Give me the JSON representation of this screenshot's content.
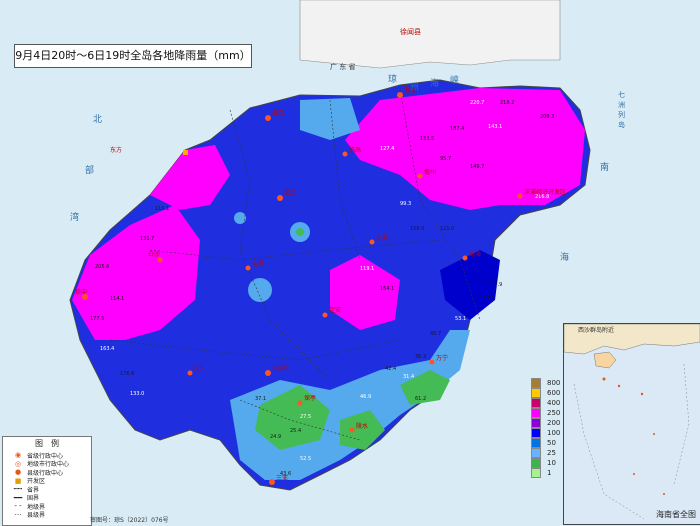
{
  "title": "9月4日20时～6日19时全岛各地降雨量（mm）",
  "sea_labels": {
    "qiongzhou": [
      "琼",
      "州",
      "海",
      "峡"
    ],
    "beibu": [
      "北",
      "部",
      "湾"
    ],
    "nanhai": [
      "南",
      "海"
    ],
    "qizhou": [
      "七",
      "洲",
      "列",
      "岛"
    ],
    "guangdong": "广 东 省",
    "xuwen": "徐闻县"
  },
  "cities": [
    "海口",
    "澄迈",
    "临高",
    "儋州",
    "洋浦经济开发区",
    "昌江",
    "东方",
    "白沙",
    "琼中",
    "屯昌",
    "定安",
    "文昌",
    "琼海",
    "万宁",
    "陵水",
    "保亭",
    "五指山",
    "乐东",
    "三亚"
  ],
  "legend": {
    "title": "图　例",
    "items": [
      {
        "label": "省级行政中心",
        "icon": "star-circle-icon"
      },
      {
        "label": "地级市行政中心",
        "icon": "double-circle-icon"
      },
      {
        "label": "县级行政中心",
        "icon": "circle-icon"
      },
      {
        "label": "开发区",
        "icon": "square-icon"
      },
      {
        "label": "省界",
        "icon": "dash-line-icon"
      },
      {
        "label": "国界",
        "icon": "border-line-icon"
      },
      {
        "label": "地级界",
        "icon": "thin-dash-icon"
      },
      {
        "label": "县级界",
        "icon": "dot-line-icon"
      }
    ]
  },
  "scale": [
    {
      "label": "800",
      "color": "#a67c2e"
    },
    {
      "label": "600",
      "color": "#ffc800"
    },
    {
      "label": "400",
      "color": "#c8006e"
    },
    {
      "label": "250",
      "color": "#ff00ff"
    },
    {
      "label": "200",
      "color": "#8c00d7"
    },
    {
      "label": "100",
      "color": "#0000ff"
    },
    {
      "label": "50",
      "color": "#0073e6"
    },
    {
      "label": "25",
      "color": "#66b3ff"
    },
    {
      "label": "10",
      "color": "#3cb44b"
    },
    {
      "label": "1",
      "color": "#a6f28f"
    }
  ],
  "inset": {
    "title": "西沙群岛附近",
    "label": "海南省全图"
  },
  "footer": "审图号：琼S（2022）076号",
  "colors": {
    "land_low": "#2233dd",
    "land_mid": "#0000cc",
    "land_high": "#ff00ff",
    "land_light": "#55aaee",
    "land_green": "#44bb55",
    "sea": "#d9ecf5"
  },
  "value_labels": [
    "220.7",
    "218.2",
    "208.3",
    "143.1",
    "187.4",
    "153.5",
    "127.4",
    "95.7",
    "149.7",
    "216.8",
    "107.9",
    "133.6",
    "53.1",
    "45.7",
    "36.3",
    "31.4",
    "42.4",
    "37.1",
    "27.5",
    "25.4",
    "24.9",
    "46.9",
    "61.2",
    "43.6",
    "52.5",
    "205.6",
    "177.5",
    "163.4",
    "114.1",
    "176.6",
    "133.0",
    "110.1",
    "131.7",
    "99.3",
    "156.0",
    "121.0",
    "119.1",
    "164.1"
  ]
}
